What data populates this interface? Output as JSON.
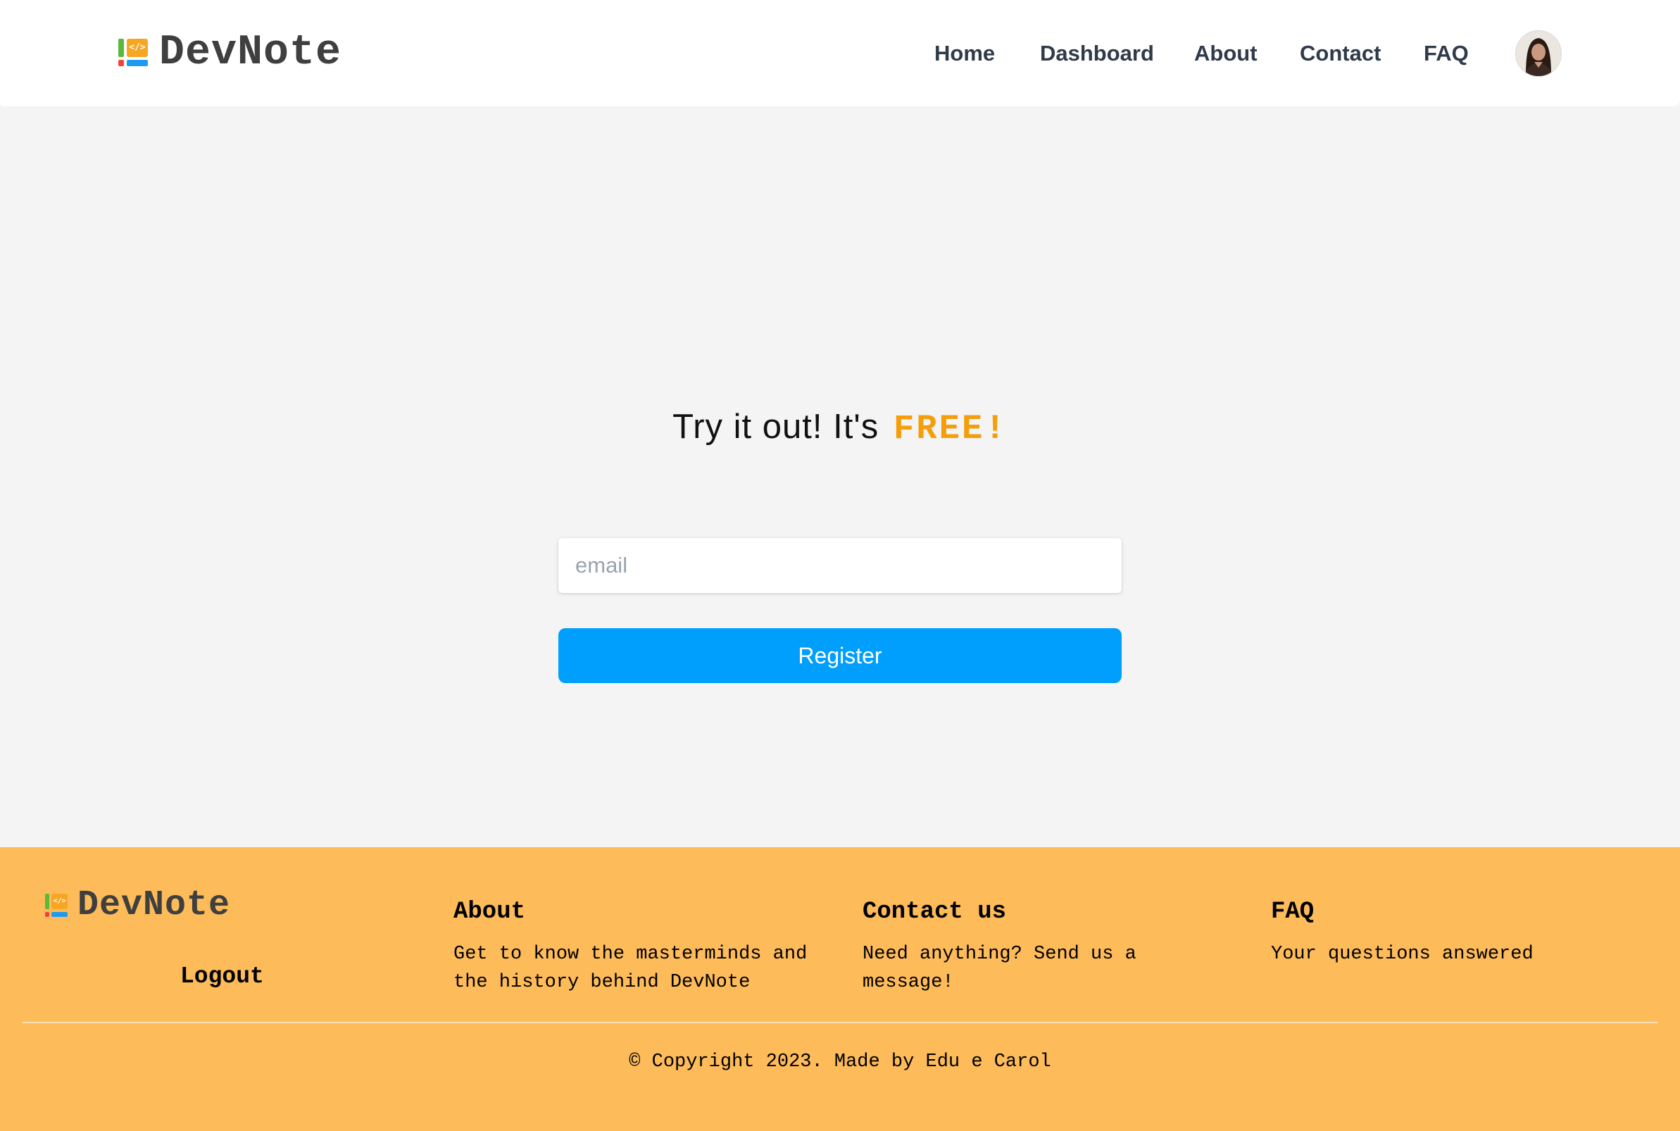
{
  "header": {
    "brand": "DevNote",
    "logo_glyph": "</>",
    "nav": [
      "Home",
      "Dashboard",
      "About",
      "Contact",
      "FAQ"
    ],
    "avatar_icon": "user-avatar"
  },
  "hero": {
    "headline_prefix": "Try it out! It's ",
    "headline_highlight": "FREE!",
    "email_placeholder": "email",
    "email_value": "",
    "register_label": "Register"
  },
  "footer": {
    "brand": "DevNote",
    "logout_label": "Logout",
    "columns": [
      {
        "title": "About",
        "text": "Get to know the masterminds and the history behind DevNote"
      },
      {
        "title": "Contact us",
        "text": "Need anything? Send us a message!"
      },
      {
        "title": "FAQ",
        "text": "Your questions answered"
      }
    ],
    "copyright": "© Copyright 2023. Made by Edu e Carol"
  },
  "colors": {
    "accent_blue": "#009ffd",
    "highlight_orange": "#f59e0b",
    "footer_bg": "#fdbb5a",
    "page_bg": "#f4f4f4",
    "nav_text": "#2f3a4a"
  }
}
